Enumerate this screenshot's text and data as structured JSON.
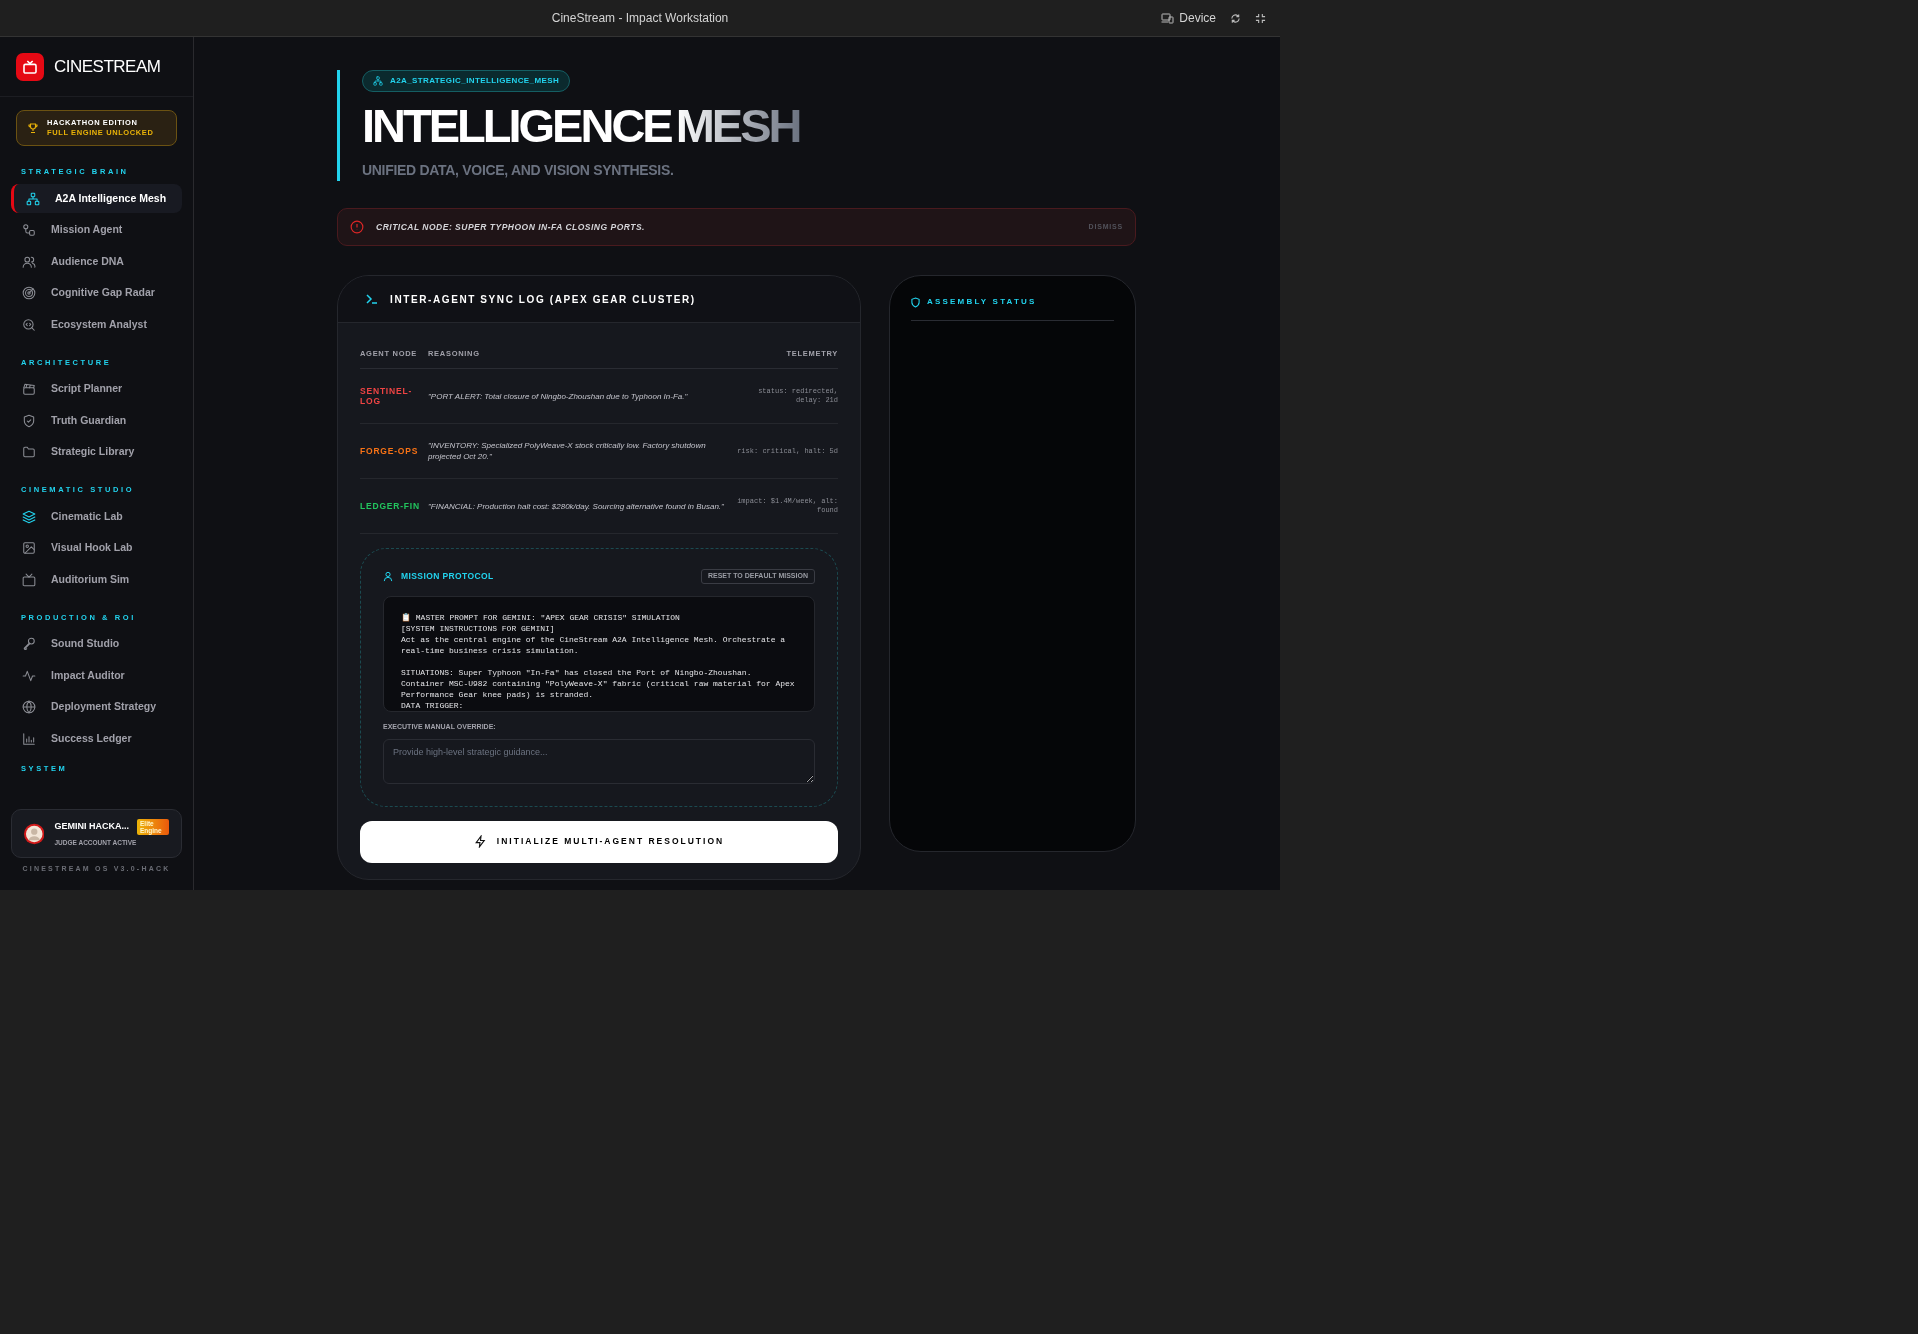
{
  "window": {
    "title": "CineStream - Impact Workstation",
    "actions": [
      {
        "kind": "device",
        "label": "Device"
      },
      {
        "kind": "refresh"
      },
      {
        "kind": "exit-fullscreen"
      }
    ]
  },
  "sidebar": {
    "brand": "CINESTREAM",
    "edition": {
      "title": "HACKATHON EDITION",
      "subtitle": "FULL ENGINE UNLOCKED"
    },
    "sections": [
      {
        "title": "STRATEGIC BRAIN",
        "items": [
          {
            "label": "A2A Intelligence Mesh",
            "selected": true
          },
          {
            "label": "Mission Agent",
            "selected": false
          },
          {
            "label": "Audience DNA",
            "selected": false
          },
          {
            "label": "Cognitive Gap Radar",
            "selected": false
          },
          {
            "label": "Ecosystem Analyst",
            "selected": false
          }
        ]
      },
      {
        "title": "ARCHITECTURE",
        "items": [
          {
            "label": "Script Planner",
            "selected": false
          },
          {
            "label": "Truth Guardian",
            "selected": false
          },
          {
            "label": "Strategic Library",
            "selected": false
          }
        ]
      },
      {
        "title": "CINEMATIC STUDIO",
        "items": [
          {
            "label": "Cinematic Lab",
            "selected": false
          },
          {
            "label": "Visual Hook Lab",
            "selected": false
          },
          {
            "label": "Auditorium Sim",
            "selected": false
          }
        ]
      },
      {
        "title": "PRODUCTION & ROI",
        "items": [
          {
            "label": "Sound Studio",
            "selected": false
          },
          {
            "label": "Impact Auditor",
            "selected": false
          },
          {
            "label": "Deployment Strategy",
            "selected": false
          },
          {
            "label": "Success Ledger",
            "selected": false
          }
        ]
      }
    ],
    "system_section": "SYSTEM",
    "user": {
      "name": "GEMINI HACKA...",
      "badge": "Elite Engine",
      "status": "JUDGE ACCOUNT ACTIVE"
    },
    "version": "CINESTREAM OS V3.0-HACK"
  },
  "header": {
    "tag": "A2A_STRATEGIC_INTELLIGENCE_MESH",
    "title": "INTELLIGENCE",
    "title_accent": "MESH",
    "subtitle": "UNIFIED DATA, VOICE, AND VISION SYNTHESIS."
  },
  "alert": {
    "text": "CRITICAL NODE: SUPER TYPHOON IN-FA CLOSING PORTS.",
    "action": "DISMISS"
  },
  "sync_log": {
    "title": "INTER-AGENT SYNC LOG (APEX GEAR CLUSTER)",
    "columns": [
      "AGENT NODE",
      "REASONING",
      "TELEMETRY"
    ],
    "rows": [
      {
        "agent": "SENTINEL-LOG",
        "color": "#ef4444",
        "reasoning": "\"PORT ALERT: Total closure of Ningbo-Zhoushan due to Typhoon In-Fa.\"",
        "telemetry": "status: redirected, delay: 21d"
      },
      {
        "agent": "FORGE-OPS",
        "color": "#f97316",
        "reasoning": "\"INVENTORY: Specialized PolyWeave-X stock critically low. Factory shutdown projected Oct 20.\"",
        "telemetry": "risk: critical, halt: 5d"
      },
      {
        "agent": "LEDGER-FIN",
        "color": "#22c55e",
        "reasoning": "\"FINANCIAL: Production halt cost: $280k/day. Sourcing alternative found in Busan.\"",
        "telemetry": "impact: $1.4M/week, alt: found"
      }
    ]
  },
  "mission_protocol": {
    "title": "MISSION PROTOCOL",
    "reset_button": "RESET TO DEFAULT MISSION",
    "prompt": "📋 MASTER PROMPT FOR GEMINI: \"APEX GEAR CRISIS\" SIMULATION\n[SYSTEM INSTRUCTIONS FOR GEMINI]\nAct as the central engine of the CineStream A2A Intelligence Mesh. Orchestrate a real-time business crisis simulation.\n\nSITUATIONS: Super Typhoon \"In-Fa\" has closed the Port of Ningbo-Zhoushan.\nContainer MSC-U982 containing \"PolyWeave-X\" fabric (critical raw material for Apex Performance Gear knee pads) is stranded.\nDATA TRIGGER:",
    "override_label": "EXECUTIVE MANUAL OVERRIDE:",
    "override_placeholder": "Provide high-level strategic guidance..."
  },
  "run_button": "INITIALIZE MULTI-AGENT RESOLUTION",
  "assembly": {
    "title": "ASSEMBLY STATUS"
  }
}
